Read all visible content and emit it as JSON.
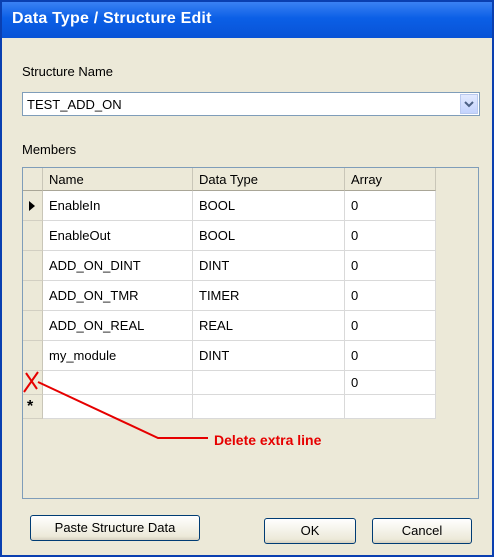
{
  "window": {
    "title": "Data Type / Structure Edit"
  },
  "structure": {
    "label": "Structure Name",
    "value": "TEST_ADD_ON"
  },
  "members": {
    "label": "Members",
    "columns": [
      "Name",
      "Data Type",
      "Array"
    ],
    "rows": [
      {
        "name": "EnableIn",
        "type": "BOOL",
        "array": "0"
      },
      {
        "name": "EnableOut",
        "type": "BOOL",
        "array": "0"
      },
      {
        "name": "ADD_ON_DINT",
        "type": "DINT",
        "array": "0"
      },
      {
        "name": "ADD_ON_TMR",
        "type": "TIMER",
        "array": "0"
      },
      {
        "name": "ADD_ON_REAL",
        "type": "REAL",
        "array": "0"
      },
      {
        "name": "my_module",
        "type": "DINT",
        "array": "0"
      },
      {
        "name": "",
        "type": "",
        "array": "0"
      }
    ],
    "new_row_marker": "*"
  },
  "annotation": {
    "text": "Delete extra line",
    "color": "#e60000"
  },
  "buttons": {
    "paste": "Paste Structure Data",
    "ok": "OK",
    "cancel": "Cancel"
  },
  "icons": {
    "dropdown": "chevron-down-icon",
    "current_row": "row-pointer-icon",
    "delete_mark": "red-x-icon"
  }
}
